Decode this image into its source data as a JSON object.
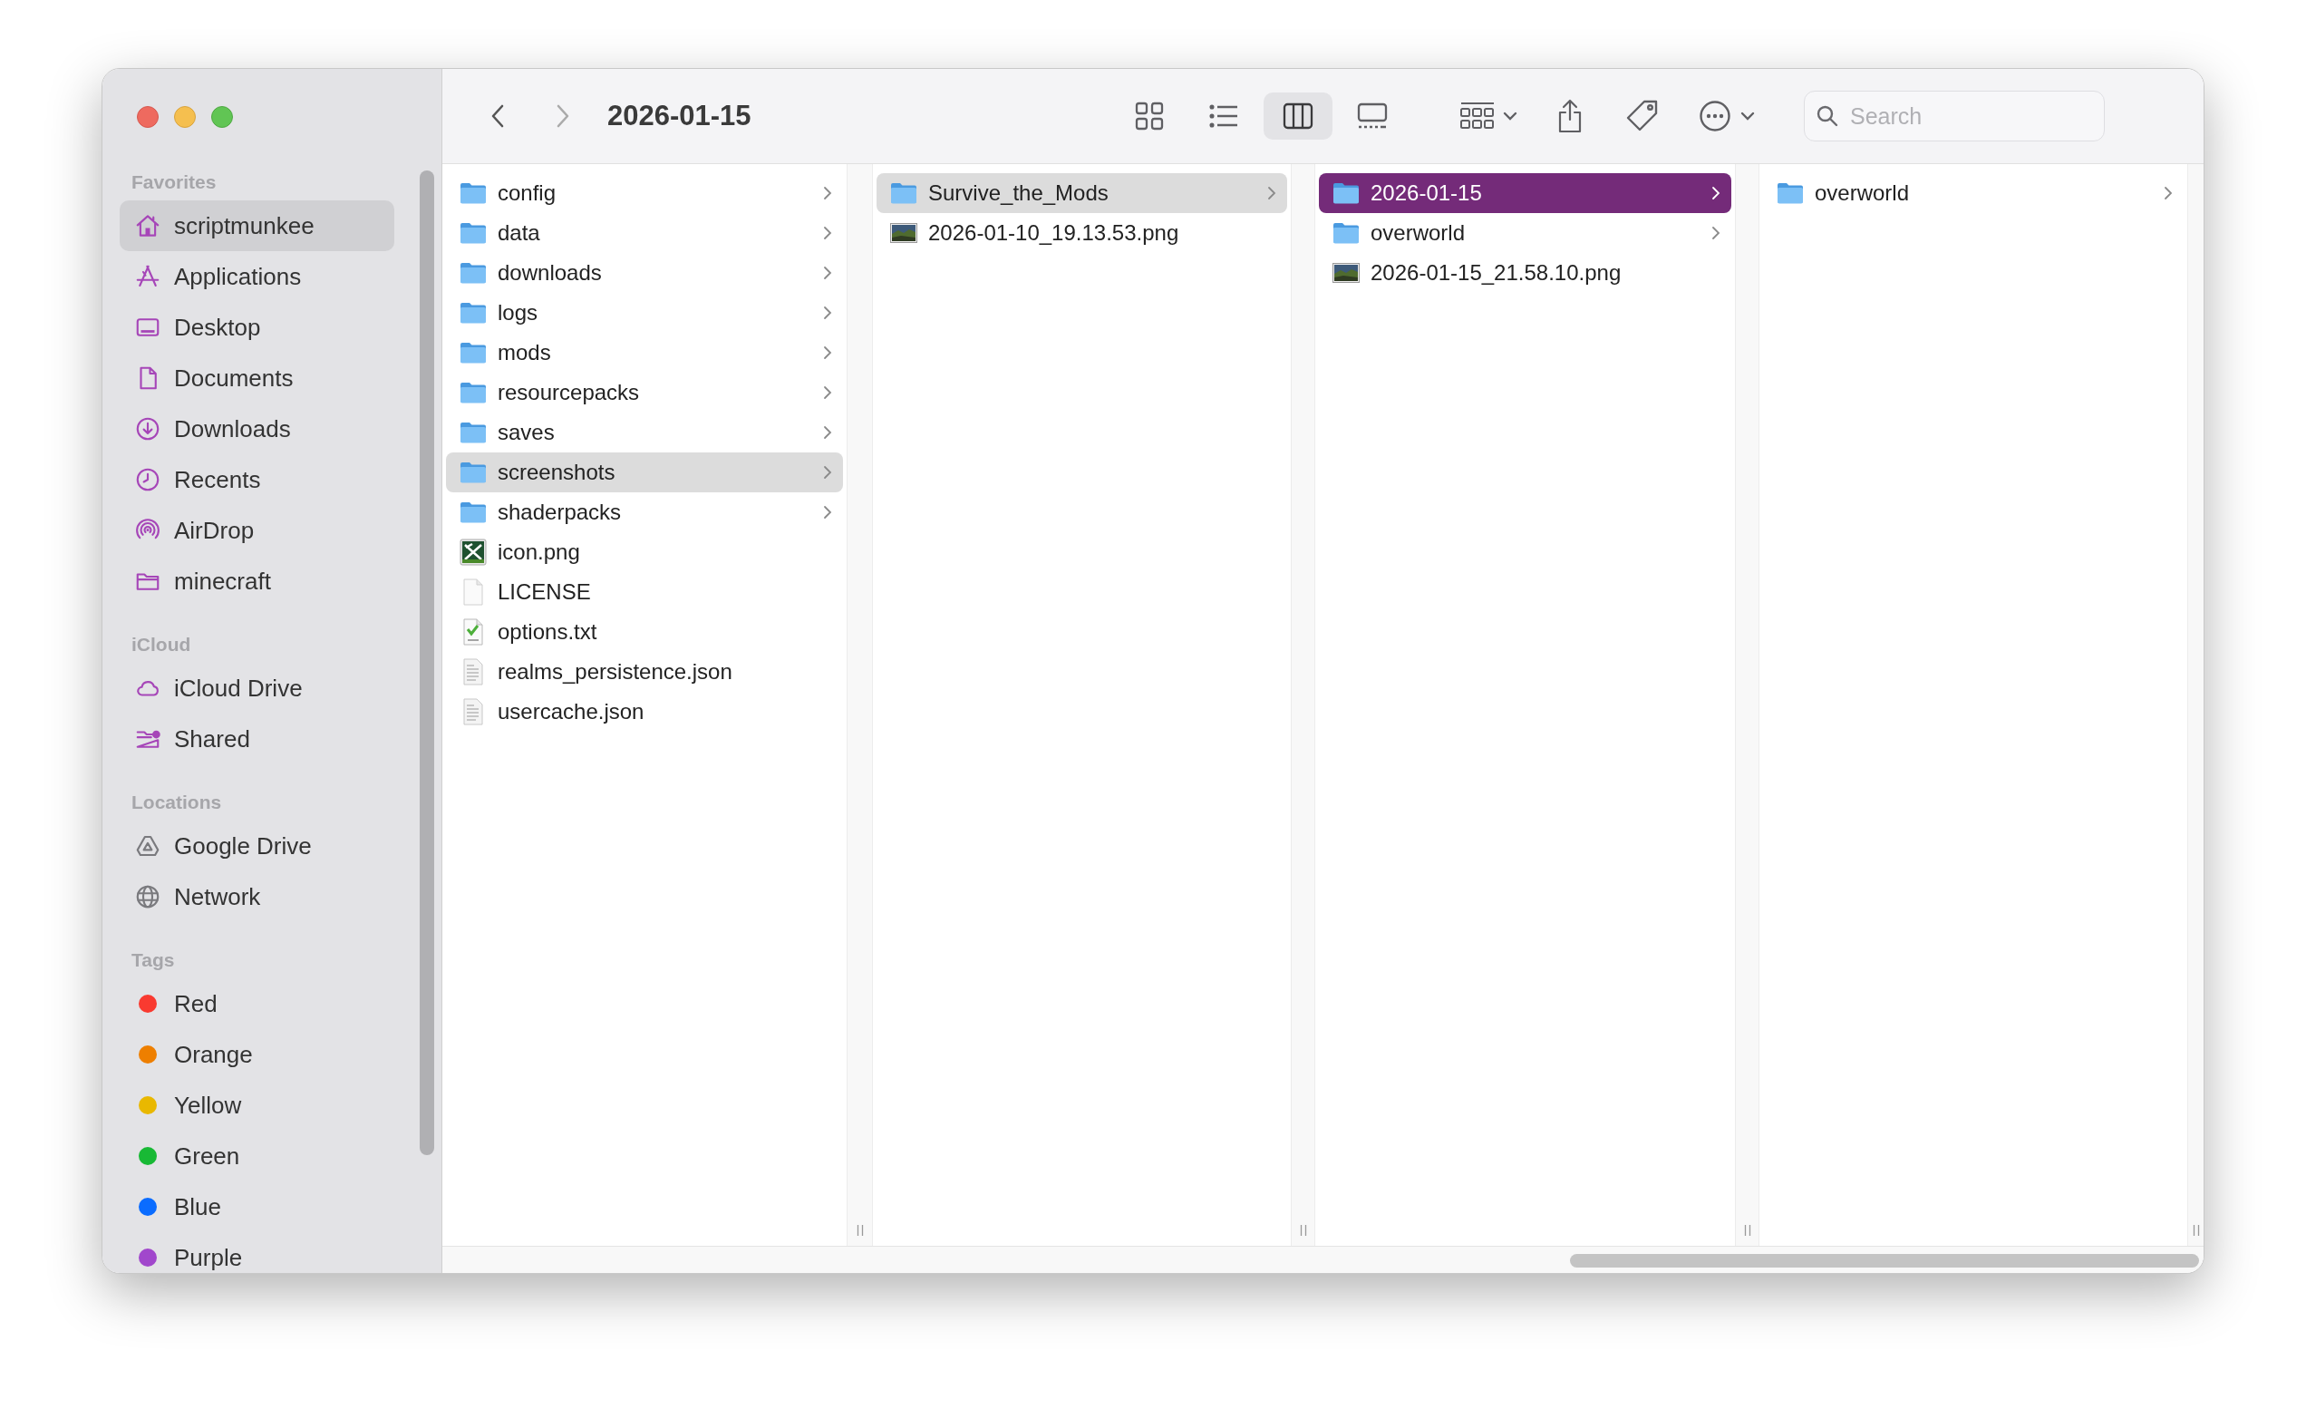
{
  "window": {
    "title": "2026-01-15"
  },
  "toolbar": {
    "view_buttons": [
      {
        "kind": "icons",
        "selected": false
      },
      {
        "kind": "list",
        "selected": false
      },
      {
        "kind": "columns",
        "selected": true
      },
      {
        "kind": "gallery",
        "selected": false
      }
    ],
    "search": {
      "placeholder": "Search"
    }
  },
  "sidebar": {
    "sections": [
      {
        "heading": "Favorites",
        "items": [
          {
            "label": "scriptmunkee",
            "kind": "home",
            "selected": true
          },
          {
            "label": "Applications",
            "kind": "apps",
            "selected": false
          },
          {
            "label": "Desktop",
            "kind": "desktop",
            "selected": false
          },
          {
            "label": "Documents",
            "kind": "document",
            "selected": false
          },
          {
            "label": "Downloads",
            "kind": "download",
            "selected": false
          },
          {
            "label": "Recents",
            "kind": "clock",
            "selected": false
          },
          {
            "label": "AirDrop",
            "kind": "airdrop",
            "selected": false
          },
          {
            "label": "minecraft",
            "kind": "folder",
            "selected": false
          }
        ]
      },
      {
        "heading": "iCloud",
        "items": [
          {
            "label": "iCloud Drive",
            "kind": "cloud",
            "selected": false
          },
          {
            "label": "Shared",
            "kind": "shared",
            "selected": false
          }
        ]
      },
      {
        "heading": "Locations",
        "items": [
          {
            "label": "Google Drive",
            "kind": "drive",
            "selected": false
          },
          {
            "label": "Network",
            "kind": "globe",
            "selected": false
          }
        ]
      },
      {
        "heading": "Tags",
        "items": [
          {
            "label": "Red",
            "kind": "tag",
            "color": "#f93a30",
            "selected": false
          },
          {
            "label": "Orange",
            "kind": "tag",
            "color": "#ee7f00",
            "selected": false
          },
          {
            "label": "Yellow",
            "kind": "tag",
            "color": "#e9b800",
            "selected": false
          },
          {
            "label": "Green",
            "kind": "tag",
            "color": "#18b935",
            "selected": false
          },
          {
            "label": "Blue",
            "kind": "tag",
            "color": "#0a6cff",
            "selected": false
          },
          {
            "label": "Purple",
            "kind": "tag",
            "color": "#a147cc",
            "selected": false
          }
        ]
      }
    ]
  },
  "columns": [
    {
      "items": [
        {
          "name": "config",
          "kind": "folder",
          "selected": false
        },
        {
          "name": "data",
          "kind": "folder",
          "selected": false
        },
        {
          "name": "downloads",
          "kind": "folder",
          "selected": false
        },
        {
          "name": "logs",
          "kind": "folder",
          "selected": false
        },
        {
          "name": "mods",
          "kind": "folder",
          "selected": false
        },
        {
          "name": "resourcepacks",
          "kind": "folder",
          "selected": false
        },
        {
          "name": "saves",
          "kind": "folder",
          "selected": false
        },
        {
          "name": "screenshots",
          "kind": "folder",
          "selected": true,
          "focused": false
        },
        {
          "name": "shaderpacks",
          "kind": "folder",
          "selected": false
        },
        {
          "name": "icon.png",
          "kind": "image",
          "selected": false
        },
        {
          "name": "LICENSE",
          "kind": "blank",
          "selected": false
        },
        {
          "name": "options.txt",
          "kind": "text",
          "selected": false
        },
        {
          "name": "realms_persistence.json",
          "kind": "json",
          "selected": false
        },
        {
          "name": "usercache.json",
          "kind": "json",
          "selected": false
        }
      ]
    },
    {
      "items": [
        {
          "name": "Survive_the_Mods",
          "kind": "folder",
          "selected": true,
          "focused": false
        },
        {
          "name": "2026-01-10_19.13.53.png",
          "kind": "photo",
          "selected": false
        }
      ]
    },
    {
      "items": [
        {
          "name": "2026-01-15",
          "kind": "folder",
          "selected": true,
          "focused": true
        },
        {
          "name": "overworld",
          "kind": "folder",
          "selected": false
        },
        {
          "name": "2026-01-15_21.58.10.png",
          "kind": "photo",
          "selected": false
        }
      ]
    },
    {
      "items": [
        {
          "name": "overworld",
          "kind": "folder",
          "selected": false
        }
      ]
    }
  ]
}
